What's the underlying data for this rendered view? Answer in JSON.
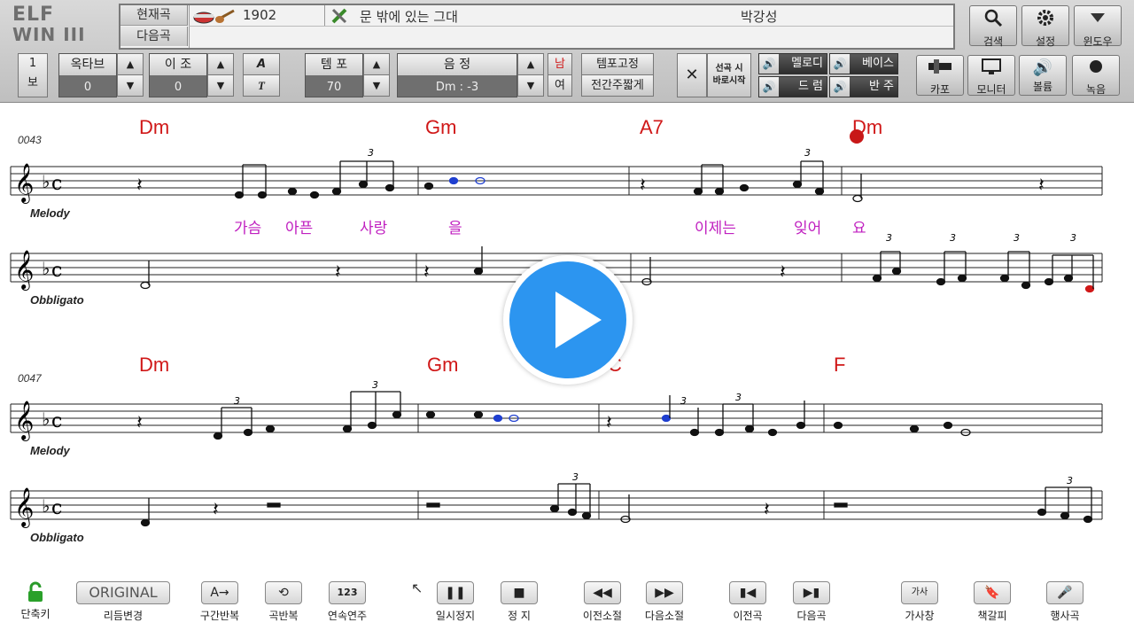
{
  "logo": {
    "line1": "ELF",
    "line2": "WIN III"
  },
  "song_panel": {
    "current_label": "현재곡",
    "next_label": "다음곡",
    "song_number": "1902",
    "song_title": "문 밖에 있는 그대",
    "singer": "박강성"
  },
  "top_buttons": [
    {
      "label": "검색",
      "icon": "search-icon"
    },
    {
      "label": "설정",
      "icon": "gear-icon"
    },
    {
      "label": "윈도우",
      "icon": "chevron-down-icon"
    }
  ],
  "controls": {
    "page_top": "1",
    "page_bottom": "보",
    "octave": {
      "label": "옥타브",
      "value": "0"
    },
    "transpose": {
      "label": "이 조",
      "value": "0"
    },
    "font_a": "A",
    "font_t": "T",
    "tempo": {
      "label": "템 포",
      "value": "70"
    },
    "pitch": {
      "label": "음 정",
      "value": "Dm : -3"
    },
    "male": "남",
    "female": "여",
    "tempo_fix": "템포고정",
    "intro_short": "전간주짧게",
    "close": "✕",
    "select_start_1": "선곡 시",
    "select_start_2": "바로시작",
    "melody": "멜로디",
    "bass": "베이스",
    "drum": "드 럼",
    "accomp": "반 주",
    "capo": "카포",
    "monitor": "모니터",
    "volume": "볼륨",
    "record": "녹음"
  },
  "score": {
    "systems": [
      {
        "bar_number": "0043",
        "chords": [
          "Dm",
          "Gm",
          "A7",
          "Dm"
        ],
        "staff1_label": "Melody",
        "staff2_label": "Obbligato",
        "lyrics": [
          "가슴",
          "아픈",
          "사랑",
          "을",
          "이제는",
          "잊어",
          "요"
        ]
      },
      {
        "bar_number": "0047",
        "chords": [
          "Dm",
          "Gm",
          "C",
          "F"
        ],
        "staff1_label": "Melody",
        "staff2_label": "Obbligato",
        "lyrics": []
      }
    ],
    "tuplet": "3"
  },
  "bottom_bar": {
    "lock": "단축키",
    "rhythm_btn": "ORIGINAL",
    "rhythm": "리듬변경",
    "section_repeat": "구간반복",
    "song_repeat": "곡반복",
    "continuous_icon": "123",
    "continuous": "연속연주",
    "pause": "일시정지",
    "stop": "정 지",
    "prev_bar": "이전소절",
    "next_bar": "다음소절",
    "prev_song": "이전곡",
    "next_song": "다음곡",
    "lyrics_icon": "가사",
    "lyrics": "가사창",
    "bookmark": "책갈피",
    "line_song": "행사곡"
  }
}
